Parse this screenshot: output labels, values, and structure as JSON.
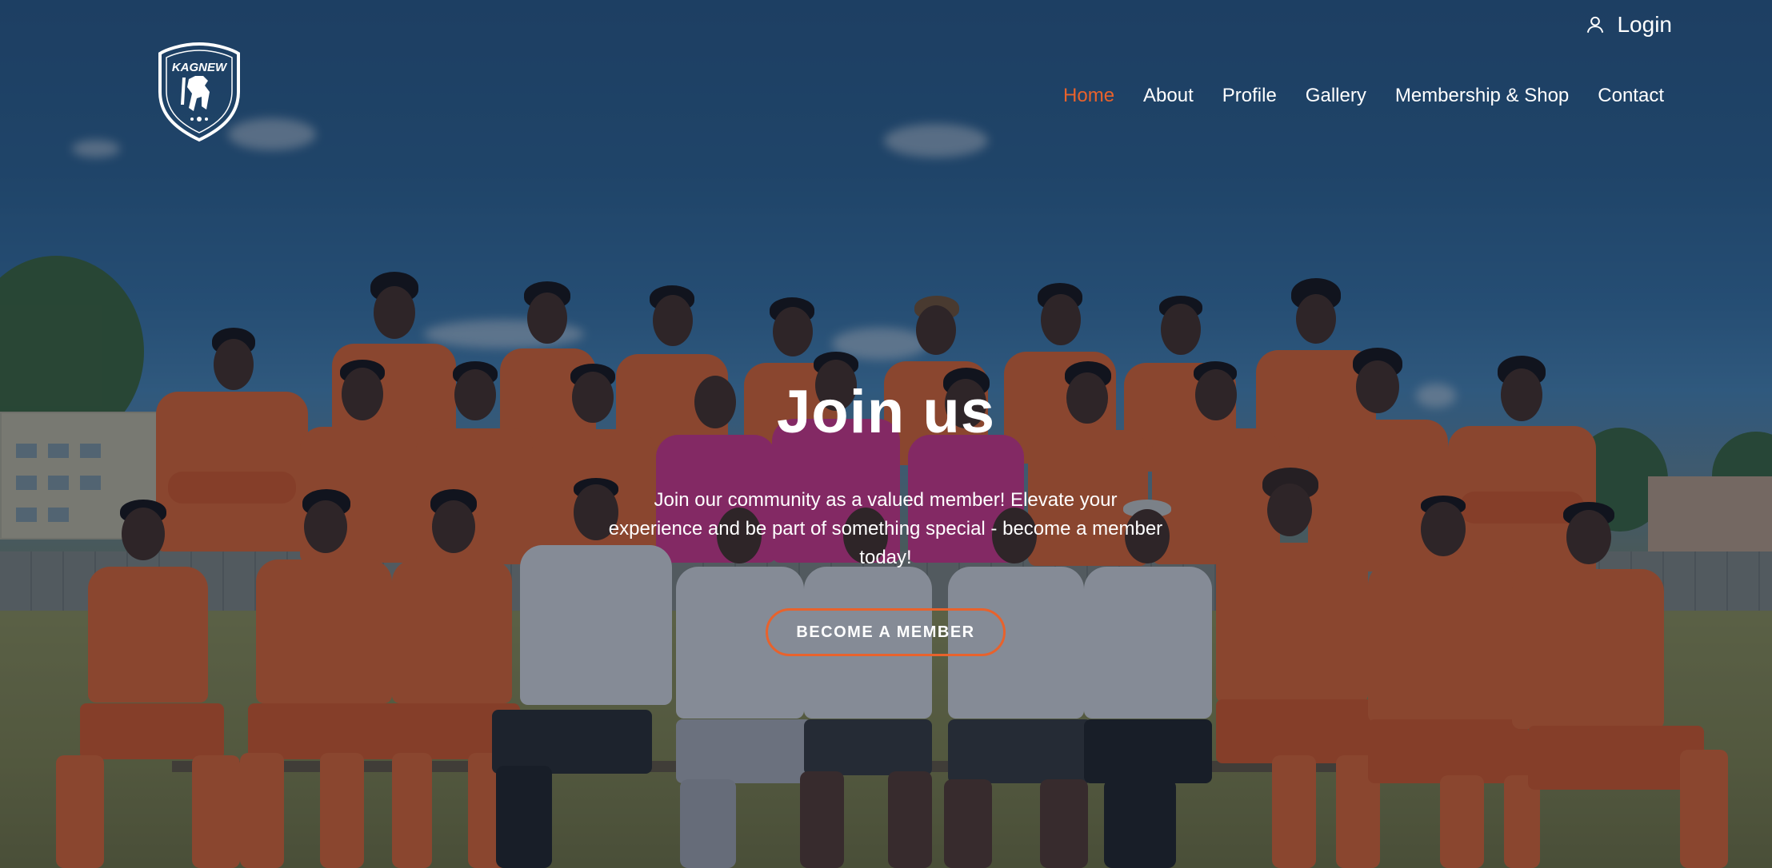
{
  "header": {
    "logo_text": "KAGNEW",
    "login_label": "Login",
    "nav": [
      {
        "label": "Home",
        "active": true
      },
      {
        "label": "About",
        "active": false
      },
      {
        "label": "Profile",
        "active": false
      },
      {
        "label": "Gallery",
        "active": false
      },
      {
        "label": "Membership & Shop",
        "active": false
      },
      {
        "label": "Contact",
        "active": false
      }
    ]
  },
  "hero": {
    "title": "Join us",
    "subtitle": "Join our community as a valued member! Elevate your experience and be part of something special - become a member today!",
    "cta_label": "BECOME A MEMBER"
  },
  "colors": {
    "accent": "#e8622c",
    "text": "#ffffff"
  },
  "icons": {
    "login": "user-icon",
    "logo": "horse-shield-logo"
  }
}
